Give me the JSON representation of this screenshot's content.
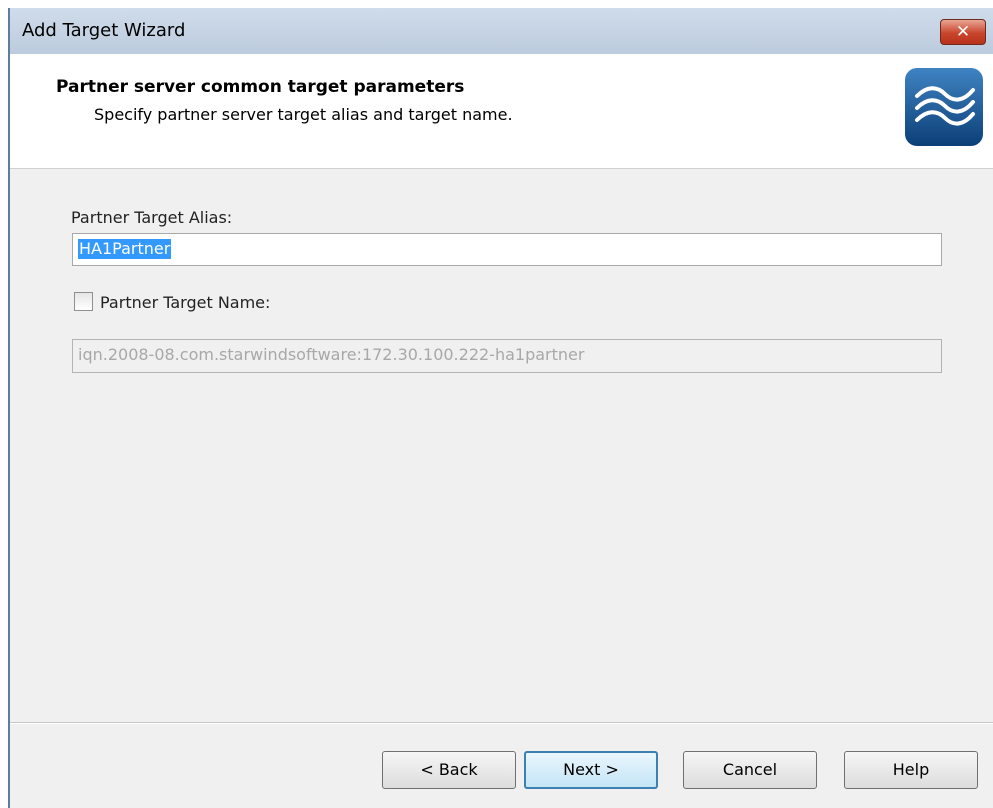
{
  "window": {
    "title": "Add Target Wizard",
    "close_glyph": "✕"
  },
  "header": {
    "title": "Partner server common target parameters",
    "subtitle": "Specify partner server target alias and target name.",
    "logo_icon": "starwind-waves-logo"
  },
  "form": {
    "alias_label": "Partner Target Alias:",
    "alias_value": "HA1Partner",
    "name_checkbox_label": "Partner Target Name:",
    "name_checkbox_checked": false,
    "name_value": "iqn.2008-08.com.starwindsoftware:172.30.100.222-ha1partner"
  },
  "buttons": {
    "back": "< Back",
    "next": "Next >",
    "cancel": "Cancel",
    "help": "Help"
  },
  "colors": {
    "selection": "#3399ff",
    "logo": "#1d5ea3",
    "close_button": "#c9452c"
  }
}
